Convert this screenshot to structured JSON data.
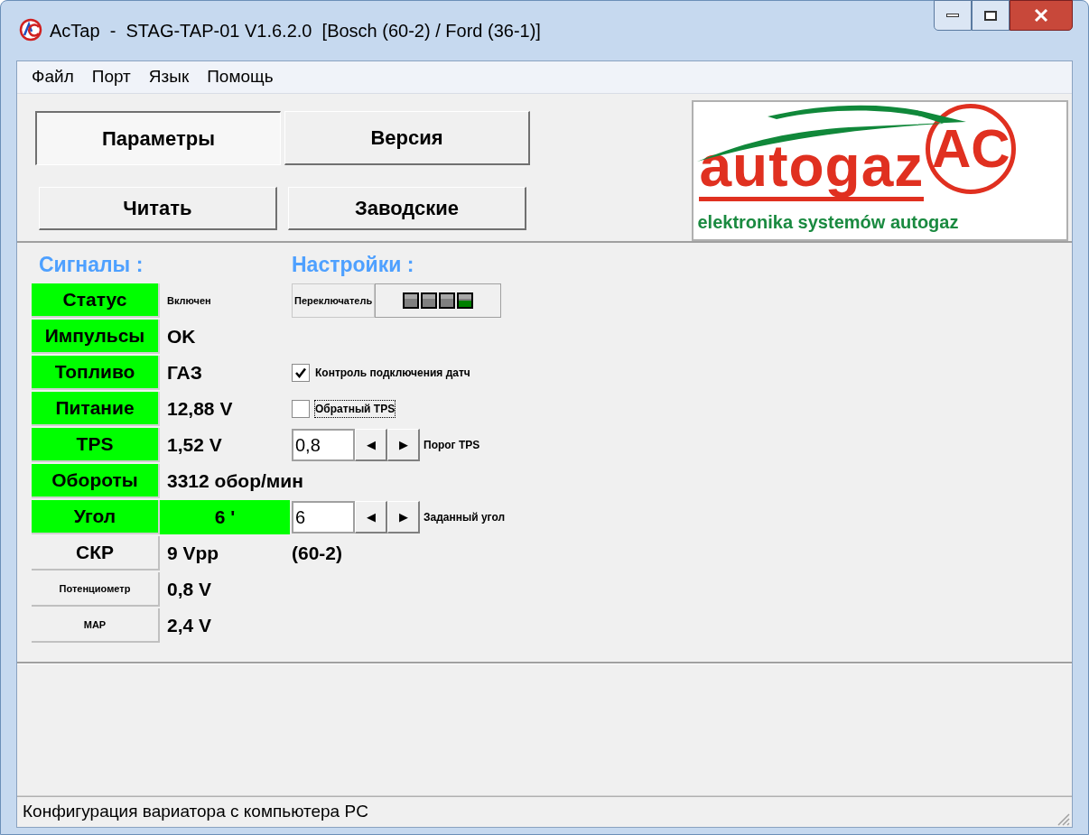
{
  "window": {
    "title": "AcTap  -  STAG-TAP-01 V1.6.2.0  [Bosch (60-2) / Ford (36-1)]"
  },
  "menu": [
    "Файл",
    "Порт",
    "Язык",
    "Помощь"
  ],
  "buttons": [
    {
      "label": "Параметры",
      "selected": true
    },
    {
      "label": "Версия",
      "selected": false
    },
    {
      "label": "Читать",
      "selected": false
    },
    {
      "label": "Заводские",
      "selected": false
    }
  ],
  "logo": {
    "brand": "autogaz",
    "mark": "AC",
    "tagline": "elektronika systemów autogaz"
  },
  "signals_heading": "Сигналы :",
  "settings_heading": "Настройки :",
  "rows": [
    {
      "signal": {
        "label": "Статус",
        "value": "Включен",
        "active": true,
        "value_active": false,
        "small_label": false,
        "small_value": true
      },
      "setting": {
        "kind": "switch",
        "label": "Переключатель",
        "lamps": [
          {
            "on": false
          },
          {
            "on": false
          },
          {
            "on": false
          },
          {
            "on": true
          }
        ]
      }
    },
    {
      "signal": {
        "label": "Импульсы",
        "value": "OK",
        "active": true,
        "value_active": false,
        "small_label": false,
        "small_value": false
      }
    },
    {
      "signal": {
        "label": "Топливо",
        "value": "ГАЗ",
        "active": true,
        "value_active": false,
        "small_label": false,
        "small_value": false
      },
      "setting": {
        "kind": "checkbox",
        "label": "Контроль подключения датч",
        "checked": true,
        "focused": false
      }
    },
    {
      "signal": {
        "label": "Питание",
        "value": "12,88 V",
        "active": true,
        "value_active": false,
        "small_label": false,
        "small_value": false
      },
      "setting": {
        "kind": "checkbox",
        "label": "Обратный TPS",
        "checked": false,
        "focused": true
      }
    },
    {
      "signal": {
        "label": "TPS",
        "value": "1,52 V",
        "active": true,
        "value_active": false,
        "small_label": false,
        "small_value": false
      },
      "setting": {
        "kind": "spinner",
        "value": "0,8",
        "left": "◀",
        "right": "▶",
        "label": "Порог TPS"
      }
    },
    {
      "signal": {
        "label": "Обороты",
        "value": "3312 обор/мин",
        "active": true,
        "value_active": false,
        "small_label": false,
        "small_value": false
      }
    },
    {
      "signal": {
        "label": "Угол",
        "value": "6 '",
        "active": true,
        "value_active": true,
        "small_label": false,
        "small_value": false
      },
      "setting": {
        "kind": "spinner",
        "value": "6",
        "left": "◀",
        "right": "▶",
        "label": "Заданный угол"
      }
    },
    {
      "signal": {
        "label": "СКР",
        "value": "9 Vpp",
        "active": false,
        "value_active": false,
        "small_label": false,
        "small_value": false
      },
      "setting": {
        "kind": "text",
        "label": "(60-2)"
      }
    },
    {
      "signal": {
        "label": "Потенциометр",
        "value": "0,8 V",
        "active": false,
        "value_active": false,
        "small_label": true,
        "small_value": false
      }
    },
    {
      "signal": {
        "label": "MAP",
        "value": "2,4 V",
        "active": false,
        "value_active": false,
        "small_label": true,
        "small_value": false
      }
    }
  ],
  "status_bar": "Конфигурация вариатора с компьютера PC"
}
